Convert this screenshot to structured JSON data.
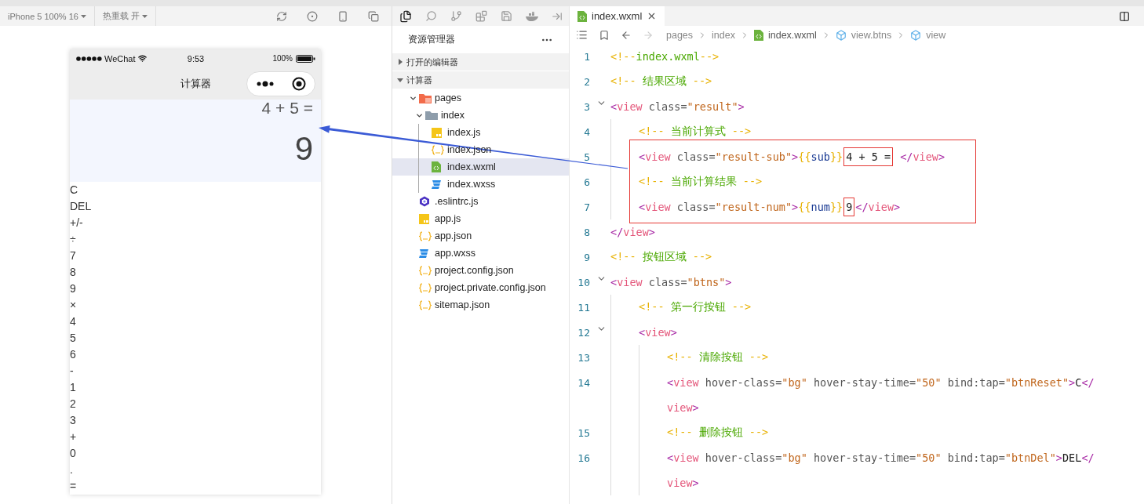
{
  "simulator": {
    "device_menu": "iPhone 5 100% 16",
    "hot_reload_menu": "热重载 开",
    "phone": {
      "carrier": "WeChat",
      "time": "9:53",
      "battery": "100%",
      "title": "计算器",
      "result_sub": "4 + 5 =",
      "result_num": "9",
      "buttons": [
        "C",
        "DEL",
        "+/-",
        "÷",
        "7",
        "8",
        "9",
        "×",
        "4",
        "5",
        "6",
        "-",
        "1",
        "2",
        "3",
        "+",
        "0",
        ".",
        "="
      ]
    }
  },
  "explorer": {
    "title": "资源管理器",
    "sections": [
      {
        "label": "打开的编辑器",
        "expanded": false
      },
      {
        "label": "计算器",
        "expanded": true,
        "children": [
          {
            "label": "pages",
            "kind": "special-folder",
            "expanded": true,
            "selected": false,
            "children": [
              {
                "label": "index",
                "kind": "folder",
                "expanded": true,
                "selected": false,
                "children": [
                  {
                    "label": "index.js",
                    "kind": "script",
                    "selected": false
                  },
                  {
                    "label": "index.json",
                    "kind": "data",
                    "selected": false
                  },
                  {
                    "label": "index.wxml",
                    "kind": "markup",
                    "selected": true
                  },
                  {
                    "label": "index.wxss",
                    "kind": "style",
                    "selected": false
                  }
                ]
              }
            ]
          },
          {
            "label": ".eslintrc.js",
            "kind": "config",
            "selected": false
          },
          {
            "label": "app.js",
            "kind": "script",
            "selected": false
          },
          {
            "label": "app.json",
            "kind": "data",
            "selected": false
          },
          {
            "label": "app.wxss",
            "kind": "style",
            "selected": false
          },
          {
            "label": "project.config.json",
            "kind": "data",
            "selected": false
          },
          {
            "label": "project.private.config.json",
            "kind": "data",
            "selected": false
          },
          {
            "label": "sitemap.json",
            "kind": "data",
            "selected": false
          }
        ]
      }
    ]
  },
  "editor": {
    "tabs": [
      {
        "label": "index.wxml",
        "selected": true
      }
    ],
    "breadcrumb": [
      {
        "label": "pages",
        "kind": "folder"
      },
      {
        "label": "index",
        "kind": "folder"
      },
      {
        "label": "index.wxml",
        "kind": "file"
      },
      {
        "label": "view.btns",
        "kind": "element"
      },
      {
        "label": "view",
        "kind": "element"
      }
    ],
    "lines": [
      {
        "number": "1",
        "tokens": [
          {
            "kind": "mark",
            "text": "<!--"
          },
          {
            "kind": "comment",
            "text": "index.wxml"
          },
          {
            "kind": "mark",
            "text": "-->"
          }
        ]
      },
      {
        "number": "2",
        "tokens": [
          {
            "kind": "mark",
            "text": "<!-- "
          },
          {
            "kind": "comment",
            "text": "结果区域"
          },
          {
            "kind": "mark",
            "text": " -->"
          }
        ]
      },
      {
        "number": "3",
        "expanded": true,
        "tokens": [
          {
            "kind": "punct",
            "text": "<"
          },
          {
            "kind": "tag",
            "text": "view"
          },
          {
            "kind": "attr",
            "text": " class="
          },
          {
            "kind": "string",
            "text": "\"result\""
          },
          {
            "kind": "punct",
            "text": ">"
          }
        ],
        "children": [
          {
            "number": "4",
            "tokens": [
              {
                "kind": "mark",
                "text": "<!-- "
              },
              {
                "kind": "comment",
                "text": "当前计算式"
              },
              {
                "kind": "mark",
                "text": " -->"
              }
            ]
          },
          {
            "number": "5",
            "highlight": true,
            "tokens": [
              {
                "kind": "punct",
                "text": "<"
              },
              {
                "kind": "tag",
                "text": "view"
              },
              {
                "kind": "attr",
                "text": " class="
              },
              {
                "kind": "string",
                "text": "\"result-sub\""
              },
              {
                "kind": "punct",
                "text": ">"
              },
              {
                "kind": "brace",
                "text": "{{"
              },
              {
                "kind": "var",
                "text": "sub"
              },
              {
                "kind": "brace",
                "text": "}}"
              },
              {
                "kind": "boxed",
                "text": "4 + 5 ="
              },
              {
                "kind": "punct",
                "text": " </"
              },
              {
                "kind": "tag",
                "text": "view"
              },
              {
                "kind": "punct",
                "text": ">"
              }
            ]
          },
          {
            "number": "6",
            "highlight": true,
            "tokens": [
              {
                "kind": "mark",
                "text": "<!-- "
              },
              {
                "kind": "comment",
                "text": "当前计算结果"
              },
              {
                "kind": "mark",
                "text": " -->"
              }
            ]
          },
          {
            "number": "7",
            "highlight": true,
            "tokens": [
              {
                "kind": "punct",
                "text": "<"
              },
              {
                "kind": "tag",
                "text": "view"
              },
              {
                "kind": "attr",
                "text": " class="
              },
              {
                "kind": "string",
                "text": "\"result-num\""
              },
              {
                "kind": "punct",
                "text": ">"
              },
              {
                "kind": "brace",
                "text": "{{"
              },
              {
                "kind": "var",
                "text": "num"
              },
              {
                "kind": "brace",
                "text": "}}"
              },
              {
                "kind": "boxed",
                "text": "9"
              },
              {
                "kind": "punct",
                "text": "</"
              },
              {
                "kind": "tag",
                "text": "view"
              },
              {
                "kind": "punct",
                "text": ">"
              }
            ]
          }
        ]
      },
      {
        "number": "8",
        "tokens": [
          {
            "kind": "punct",
            "text": "</"
          },
          {
            "kind": "tag",
            "text": "view"
          },
          {
            "kind": "punct",
            "text": ">"
          }
        ]
      },
      {
        "number": "9",
        "tokens": [
          {
            "kind": "mark",
            "text": "<!-- "
          },
          {
            "kind": "comment",
            "text": "按钮区域"
          },
          {
            "kind": "mark",
            "text": " -->"
          }
        ]
      },
      {
        "number": "10",
        "expanded": true,
        "tokens": [
          {
            "kind": "punct",
            "text": "<"
          },
          {
            "kind": "tag",
            "text": "view"
          },
          {
            "kind": "attr",
            "text": " class="
          },
          {
            "kind": "string",
            "text": "\"btns\""
          },
          {
            "kind": "punct",
            "text": ">"
          }
        ],
        "children": [
          {
            "number": "11",
            "tokens": [
              {
                "kind": "mark",
                "text": "<!-- "
              },
              {
                "kind": "comment",
                "text": "第一行按钮"
              },
              {
                "kind": "mark",
                "text": " -->"
              }
            ]
          },
          {
            "number": "12",
            "expanded": true,
            "tokens": [
              {
                "kind": "punct",
                "text": "<"
              },
              {
                "kind": "tag",
                "text": "view"
              },
              {
                "kind": "punct",
                "text": ">"
              }
            ],
            "children": [
              {
                "number": "13",
                "tokens": [
                  {
                    "kind": "mark",
                    "text": "<!-- "
                  },
                  {
                    "kind": "comment",
                    "text": "清除按钮"
                  },
                  {
                    "kind": "mark",
                    "text": " -->"
                  }
                ]
              },
              {
                "number": "14",
                "tokens": [
                  {
                    "kind": "punct",
                    "text": "<"
                  },
                  {
                    "kind": "tag",
                    "text": "view"
                  },
                  {
                    "kind": "attr",
                    "text": " hover-class="
                  },
                  {
                    "kind": "string",
                    "text": "\"bg\""
                  },
                  {
                    "kind": "attr",
                    "text": " hover-stay-time="
                  },
                  {
                    "kind": "string",
                    "text": "\"50\""
                  },
                  {
                    "kind": "attr",
                    "text": " bind:tap="
                  },
                  {
                    "kind": "string",
                    "text": "\"btnReset\""
                  },
                  {
                    "kind": "punct",
                    "text": ">"
                  },
                  {
                    "kind": "text",
                    "text": "C"
                  },
                  {
                    "kind": "punct",
                    "text": "</"
                  }
                ],
                "wrapped": [
                  {
                    "kind": "tag",
                    "text": "view"
                  },
                  {
                    "kind": "punct",
                    "text": ">"
                  }
                ]
              },
              {
                "number": "15",
                "tokens": [
                  {
                    "kind": "mark",
                    "text": "<!-- "
                  },
                  {
                    "kind": "comment",
                    "text": "删除按钮"
                  },
                  {
                    "kind": "mark",
                    "text": " -->"
                  }
                ]
              },
              {
                "number": "16",
                "tokens": [
                  {
                    "kind": "punct",
                    "text": "<"
                  },
                  {
                    "kind": "tag",
                    "text": "view"
                  },
                  {
                    "kind": "attr",
                    "text": " hover-class="
                  },
                  {
                    "kind": "string",
                    "text": "\"bg\""
                  },
                  {
                    "kind": "attr",
                    "text": " hover-stay-time="
                  },
                  {
                    "kind": "string",
                    "text": "\"50\""
                  },
                  {
                    "kind": "attr",
                    "text": " bind:tap="
                  },
                  {
                    "kind": "string",
                    "text": "\"btnDel\""
                  },
                  {
                    "kind": "punct",
                    "text": ">"
                  },
                  {
                    "kind": "text",
                    "text": "DEL"
                  },
                  {
                    "kind": "punct",
                    "text": "</"
                  }
                ],
                "wrapped": [
                  {
                    "kind": "tag",
                    "text": "view"
                  },
                  {
                    "kind": "punct",
                    "text": ">"
                  }
                ]
              }
            ]
          }
        ]
      }
    ]
  }
}
